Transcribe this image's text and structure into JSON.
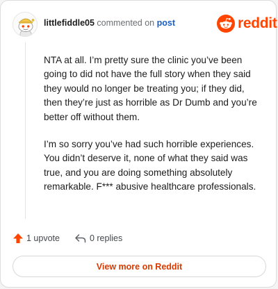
{
  "header": {
    "username": "littlefiddle05",
    "action_text": "commented on",
    "post_link": "post",
    "brand": "reddit"
  },
  "comment": {
    "paragraphs": [
      "NTA at all. I’m pretty sure the clinic you’ve been going to did not have the full story when they said they would no longer be treating you; if they did, then they’re just as horrible as Dr Dumb and you’re better off without them.",
      "I’m so sorry you’ve had such horrible experiences. You didn’t deserve it, none of what they said was true, and you are doing something absolutely remarkable. F*** abusive healthcare professionals."
    ]
  },
  "actions": {
    "upvote_label": "1 upvote",
    "replies_label": "0 replies"
  },
  "footer": {
    "view_more_label": "View more on Reddit"
  },
  "colors": {
    "brand_orange": "#ff4500",
    "link_blue": "#1a5ec4",
    "cta_text": "#d93a00"
  },
  "icons": {
    "avatar": "snoo-avatar-with-cap",
    "upvote": "upvote-arrow-icon",
    "reply": "reply-arrow-icon",
    "logo": "reddit-snoo-icon"
  }
}
